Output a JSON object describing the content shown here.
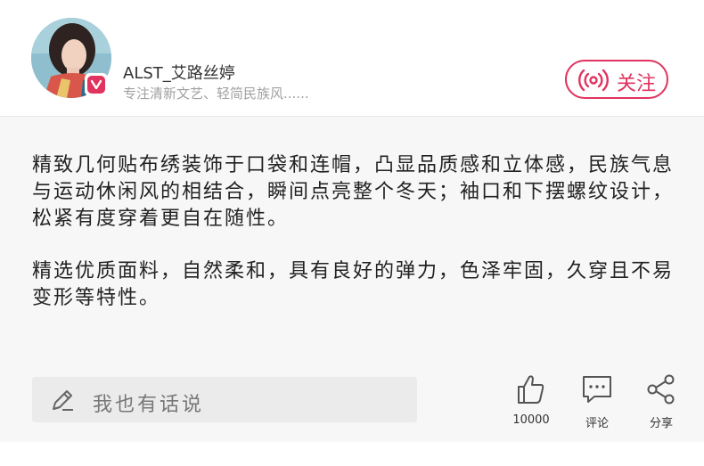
{
  "author": {
    "name": "ALST_艾路丝婷",
    "bio": "专注清新文艺、轻简民族风......"
  },
  "follow": {
    "label": "关注"
  },
  "post": {
    "paragraphs": [
      "精致几何贴布绣装饰于口袋和连帽，凸显品质感和立体感，民族气息与运动休闲风的相结合，瞬间点亮整个冬天；袖口和下摆螺纹设计，松紧有度穿着更自在随性。",
      "精选优质面料，自然柔和，具有良好的弹力，色泽牢固，久穿且不易变形等特性。"
    ]
  },
  "comment_input": {
    "placeholder": "我也有话说"
  },
  "actions": {
    "like_count": "10000",
    "comment_label": "评论",
    "share_label": "分享"
  },
  "colors": {
    "accent": "#e0335f",
    "content_bg": "#f7f7f7",
    "input_bg": "#ebebeb"
  },
  "icons": [
    "pen-icon",
    "broadcast-icon",
    "thumbs-up-icon",
    "comment-icon",
    "share-icon",
    "v-badge-icon"
  ]
}
